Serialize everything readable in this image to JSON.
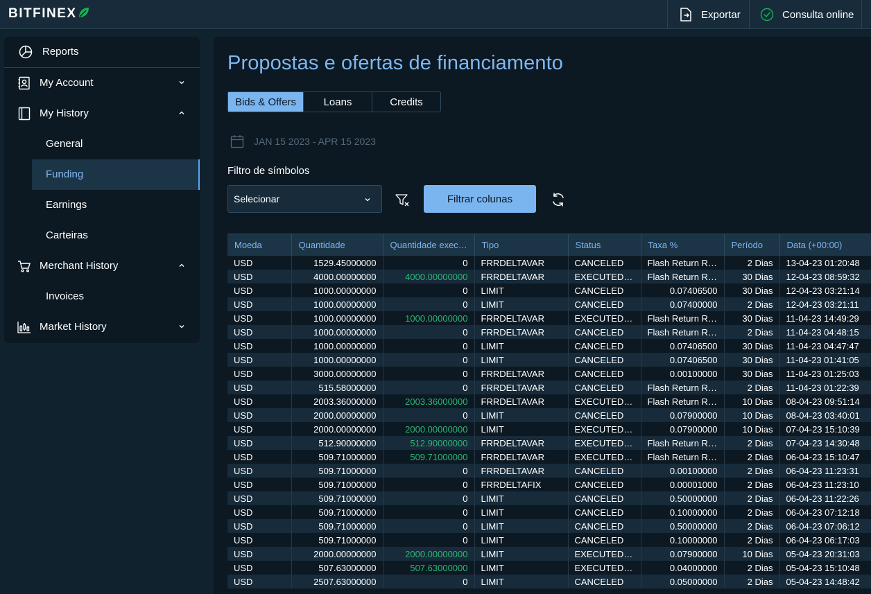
{
  "brand": {
    "name": "BITFINEX",
    "leaf_color": "#16b157"
  },
  "topbar": {
    "export_label": "Exportar",
    "online_label": "Consulta online"
  },
  "sidebar": {
    "items": [
      {
        "label": "Reports",
        "icon": "pie-chart-icon"
      },
      {
        "label": "My Account",
        "icon": "id-badge-icon",
        "expanded": false
      },
      {
        "label": "My History",
        "icon": "book-icon",
        "expanded": true
      },
      {
        "label": "General"
      },
      {
        "label": "Funding",
        "active": true
      },
      {
        "label": "Earnings"
      },
      {
        "label": "Carteiras"
      },
      {
        "label": "Merchant History",
        "icon": "cart-icon",
        "expanded": true
      },
      {
        "label": "Invoices"
      },
      {
        "label": "Market History",
        "icon": "candlestick-icon",
        "expanded": false
      }
    ]
  },
  "main": {
    "title": "Propostas e ofertas de financiamento",
    "tabs": [
      {
        "label": "Bids & Offers",
        "active": true
      },
      {
        "label": "Loans"
      },
      {
        "label": "Credits"
      }
    ],
    "date_range": "JAN 15 2023 - APR 15 2023",
    "filter_label": "Filtro de símbolos",
    "select_value": "Selecionar",
    "filter_columns_label": "Filtrar colunas"
  },
  "table": {
    "columns": [
      "Moeda",
      "Quantidade",
      "Quantidade exec…",
      "Tipo",
      "Status",
      "Taxa %",
      "Período",
      "Data (+00:00)"
    ],
    "rows": [
      [
        "USD",
        "1529.45000000",
        "0",
        "FRRDELTAVAR",
        "CANCELED",
        "Flash Return Ra…",
        "2 Dias",
        "13-04-23 01:20:48"
      ],
      [
        "USD",
        "4000.00000000",
        "4000.00000000",
        "FRRDELTAVAR",
        "EXECUTED a…",
        "Flash Return Ra…",
        "30 Dias",
        "12-04-23 08:59:32"
      ],
      [
        "USD",
        "1000.00000000",
        "0",
        "LIMIT",
        "CANCELED",
        "0.07406500",
        "30 Dias",
        "12-04-23 03:21:14"
      ],
      [
        "USD",
        "1000.00000000",
        "0",
        "LIMIT",
        "CANCELED",
        "0.07400000",
        "2 Dias",
        "12-04-23 03:21:11"
      ],
      [
        "USD",
        "1000.00000000",
        "1000.00000000",
        "FRRDELTAVAR",
        "EXECUTED a…",
        "Flash Return Ra…",
        "30 Dias",
        "11-04-23 14:49:29"
      ],
      [
        "USD",
        "1000.00000000",
        "0",
        "FRRDELTAVAR",
        "CANCELED",
        "Flash Return Ra…",
        "2 Dias",
        "11-04-23 04:48:15"
      ],
      [
        "USD",
        "1000.00000000",
        "0",
        "LIMIT",
        "CANCELED",
        "0.07406500",
        "30 Dias",
        "11-04-23 04:47:47"
      ],
      [
        "USD",
        "1000.00000000",
        "0",
        "LIMIT",
        "CANCELED",
        "0.07406500",
        "30 Dias",
        "11-04-23 01:41:05"
      ],
      [
        "USD",
        "3000.00000000",
        "0",
        "FRRDELTAVAR",
        "CANCELED",
        "0.00100000",
        "30 Dias",
        "11-04-23 01:25:03"
      ],
      [
        "USD",
        "515.58000000",
        "0",
        "FRRDELTAVAR",
        "CANCELED",
        "Flash Return Ra…",
        "2 Dias",
        "11-04-23 01:22:39"
      ],
      [
        "USD",
        "2003.36000000",
        "2003.36000000",
        "FRRDELTAVAR",
        "EXECUTED a…",
        "Flash Return Ra…",
        "10 Dias",
        "08-04-23 09:51:14"
      ],
      [
        "USD",
        "2000.00000000",
        "0",
        "LIMIT",
        "CANCELED",
        "0.07900000",
        "10 Dias",
        "08-04-23 03:40:01"
      ],
      [
        "USD",
        "2000.00000000",
        "2000.00000000",
        "LIMIT",
        "EXECUTED a…",
        "0.07900000",
        "10 Dias",
        "07-04-23 15:10:39"
      ],
      [
        "USD",
        "512.90000000",
        "512.90000000",
        "FRRDELTAVAR",
        "EXECUTED a…",
        "Flash Return Ra…",
        "2 Dias",
        "07-04-23 14:30:48"
      ],
      [
        "USD",
        "509.71000000",
        "509.71000000",
        "FRRDELTAVAR",
        "EXECUTED a…",
        "Flash Return Ra…",
        "2 Dias",
        "06-04-23 15:10:47"
      ],
      [
        "USD",
        "509.71000000",
        "0",
        "FRRDELTAVAR",
        "CANCELED",
        "0.00100000",
        "2 Dias",
        "06-04-23 11:23:31"
      ],
      [
        "USD",
        "509.71000000",
        "0",
        "FRRDELTAFIX",
        "CANCELED",
        "0.00001000",
        "2 Dias",
        "06-04-23 11:23:10"
      ],
      [
        "USD",
        "509.71000000",
        "0",
        "LIMIT",
        "CANCELED",
        "0.50000000",
        "2 Dias",
        "06-04-23 11:22:26"
      ],
      [
        "USD",
        "509.71000000",
        "0",
        "LIMIT",
        "CANCELED",
        "0.10000000",
        "2 Dias",
        "06-04-23 07:12:18"
      ],
      [
        "USD",
        "509.71000000",
        "0",
        "LIMIT",
        "CANCELED",
        "0.50000000",
        "2 Dias",
        "06-04-23 07:06:12"
      ],
      [
        "USD",
        "509.71000000",
        "0",
        "LIMIT",
        "CANCELED",
        "0.10000000",
        "2 Dias",
        "06-04-23 06:17:03"
      ],
      [
        "USD",
        "2000.00000000",
        "2000.00000000",
        "LIMIT",
        "EXECUTED a…",
        "0.07900000",
        "10 Dias",
        "05-04-23 20:31:03"
      ],
      [
        "USD",
        "507.63000000",
        "507.63000000",
        "LIMIT",
        "EXECUTED a…",
        "0.04000000",
        "2 Dias",
        "05-04-23 15:10:48"
      ],
      [
        "USD",
        "2507.63000000",
        "0",
        "LIMIT",
        "CANCELED",
        "0.05000000",
        "2 Dias",
        "05-04-23 14:48:42"
      ]
    ]
  },
  "colors": {
    "accent": "#7bb5f0",
    "executed_green": "#2bb673"
  }
}
